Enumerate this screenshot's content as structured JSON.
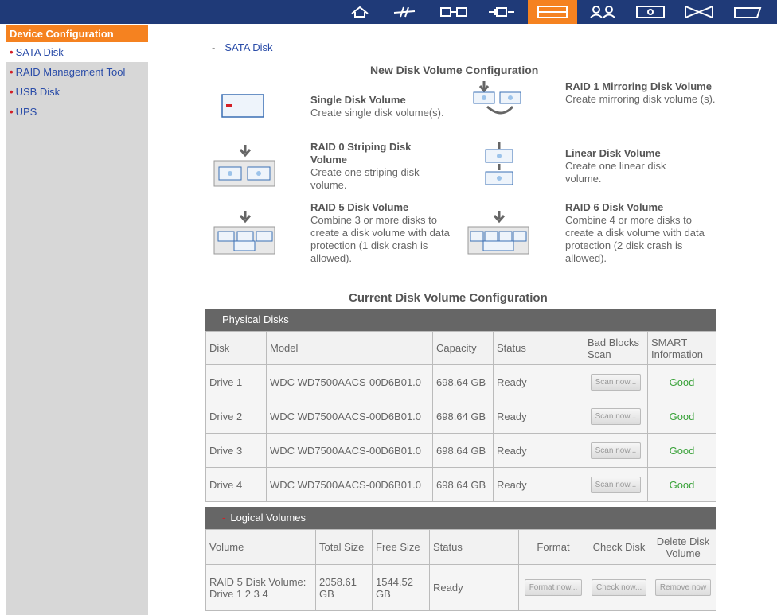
{
  "topbar": {
    "icons": [
      {
        "name": "home-icon"
      },
      {
        "name": "network-icon"
      },
      {
        "name": "device-icon"
      },
      {
        "name": "connector-icon"
      },
      {
        "name": "disk-config-icon",
        "active": true
      },
      {
        "name": "users-icon"
      },
      {
        "name": "monitor-icon"
      },
      {
        "name": "share-icon"
      },
      {
        "name": "folder-icon"
      }
    ],
    "active_color": "#f58220",
    "bar_color": "#1f3a78"
  },
  "sidebar": {
    "title": "Device Configuration",
    "items": [
      {
        "label": "SATA Disk",
        "active": true
      },
      {
        "label": "RAID Management Tool"
      },
      {
        "label": "USB Disk"
      },
      {
        "label": "UPS"
      }
    ]
  },
  "main": {
    "section_label": "SATA Disk",
    "section_dash": "-",
    "new_config_title": "New Disk Volume Configuration",
    "options": [
      {
        "title": "Single Disk Volume",
        "desc": "Create single disk volume(s)."
      },
      {
        "title": "RAID 1 Mirroring Disk Volume",
        "desc": "Create mirroring disk volume (s)."
      },
      {
        "title": "RAID 0 Striping Disk Volume",
        "desc": "Create one striping disk volume."
      },
      {
        "title": "Linear Disk Volume",
        "desc": "Create one linear disk volume."
      },
      {
        "title": "RAID 5 Disk Volume",
        "desc": "Combine 3 or more disks to create a disk volume with data protection (1 disk crash is allowed)."
      },
      {
        "title": "RAID 6 Disk Volume",
        "desc": "Combine 4 or more disks to create a disk volume with data protection (2 disk crash is allowed)."
      }
    ],
    "current_config_title": "Current Disk Volume Configuration"
  },
  "physical_disks": {
    "header": "Physical Disks",
    "columns": [
      "Disk",
      "Model",
      "Capacity",
      "Status",
      "Bad Blocks Scan",
      "SMART Information"
    ],
    "rows": [
      {
        "disk": "Drive 1",
        "model": "WDC WD7500AACS-00D6B01.0",
        "capacity": "698.64 GB",
        "status": "Ready",
        "scan": "Scan now...",
        "smart": "Good"
      },
      {
        "disk": "Drive 2",
        "model": "WDC WD7500AACS-00D6B01.0",
        "capacity": "698.64 GB",
        "status": "Ready",
        "scan": "Scan now...",
        "smart": "Good"
      },
      {
        "disk": "Drive 3",
        "model": "WDC WD7500AACS-00D6B01.0",
        "capacity": "698.64 GB",
        "status": "Ready",
        "scan": "Scan now...",
        "smart": "Good"
      },
      {
        "disk": "Drive 4",
        "model": "WDC WD7500AACS-00D6B01.0",
        "capacity": "698.64 GB",
        "status": "Ready",
        "scan": "Scan now...",
        "smart": "Good"
      }
    ]
  },
  "logical_volumes": {
    "header": "Logical Volumes",
    "header_dash": "-",
    "columns": [
      "Volume",
      "Total Size",
      "Free Size",
      "Status",
      "Format",
      "Check Disk",
      "Delete Disk Volume"
    ],
    "rows": [
      {
        "volume": "RAID 5 Disk Volume: Drive 1 2 3 4",
        "total": "2058.61 GB",
        "free": "1544.52 GB",
        "status": "Ready",
        "format": "Format now...",
        "check": "Check now...",
        "delete": "Remove now"
      }
    ]
  }
}
